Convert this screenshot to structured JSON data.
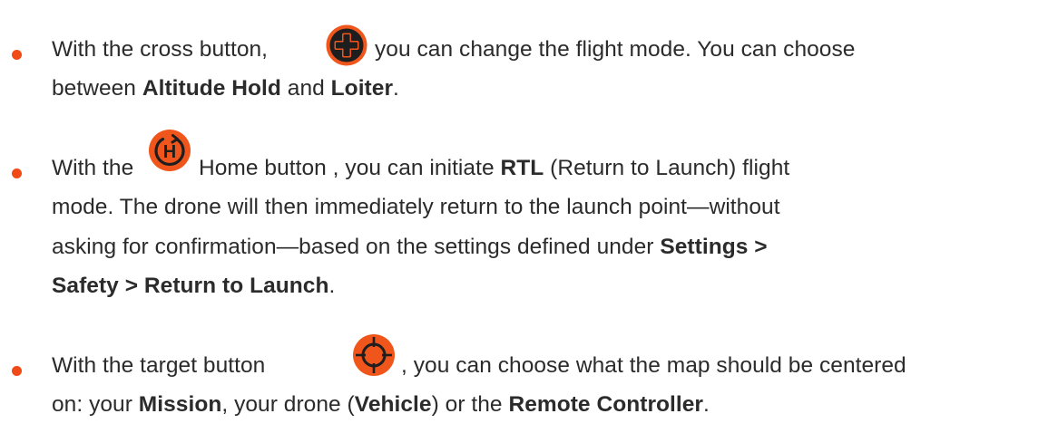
{
  "colors": {
    "bullet": "#f04a16",
    "icon_orange": "#f0561c",
    "icon_dark": "#1e1e1e",
    "text": "#2b2b2b"
  },
  "items": [
    {
      "icon": "cross-dpad-icon",
      "line1": {
        "before_icon": "With the cross button,",
        "after_icon": "you can change the flight mode. You can choose"
      },
      "line2": {
        "t1": "between ",
        "b1": "Altitude Hold",
        "t2": " and ",
        "b2": "Loiter",
        "t3": "."
      }
    },
    {
      "icon": "home-return-icon",
      "line1": {
        "before_icon": "With the",
        "after_icon": "Home button , you can initiate ",
        "bold": "RTL",
        "rest": " (Return to Launch) flight"
      },
      "line2": "mode. The drone will then immediately return to the launch point—without",
      "line3": {
        "t1": "asking for confirmation—based on the settings defined under ",
        "b1": "Settings >"
      },
      "line4": {
        "b1": "Safety > Return to Launch",
        "t1": "."
      }
    },
    {
      "icon": "target-crosshair-icon",
      "line1": {
        "before_icon": "With the target button",
        "after_icon": ", you can choose what the map should be centered"
      },
      "line2": {
        "t1": "on: your ",
        "b1": "Mission",
        "t2": ", your drone (",
        "b2": "Vehicle",
        "t3": ") or the ",
        "b3": "Remote Controller",
        "t4": "."
      }
    }
  ]
}
